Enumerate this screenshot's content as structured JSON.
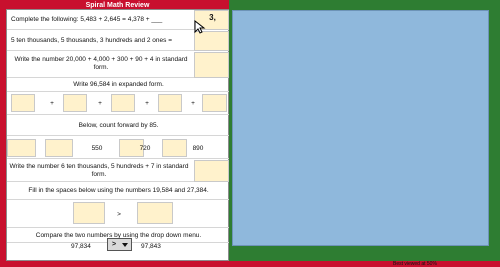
{
  "app": {
    "title": "Spiral Math Review"
  },
  "questions": {
    "q1": {
      "prompt": "Complete the following: 5,483 + 2,645 = 4,378 + ___",
      "answer": "3,"
    },
    "q2": {
      "prompt": "5 ten thousands, 5 thousands, 3 hundreds and 2 ones ="
    },
    "q3": {
      "prompt": "Write the number 20,000 + 4,000 + 300 + 90 + 4 in standard form."
    },
    "q4": {
      "prompt": "Write 96,584 in expanded form.",
      "plus": [
        "+",
        "+",
        "+",
        "+"
      ]
    },
    "q5": {
      "prompt": "Below, count forward by 85.",
      "values": [
        "550",
        "720",
        "890"
      ]
    },
    "q6": {
      "prompt": "Write the number 6 ten thousands, 5 hundreds + 7 in standard form."
    },
    "q7": {
      "prompt": "Fill in the spaces below using the numbers 19,584 and 27,384.",
      "operator": ">"
    },
    "q8": {
      "prompt": "Compare the two numbers by using the drop down menu.",
      "left_value": "97,834",
      "right_value": "97,843",
      "selected": ">"
    }
  },
  "footer": {
    "text": "Best viewed at 50%"
  },
  "colors": {
    "outer_red": "#c8102e",
    "inner_green": "#2e7d32",
    "panel_blue": "#8fb8dc",
    "input_yellow": "#fff2cc"
  }
}
